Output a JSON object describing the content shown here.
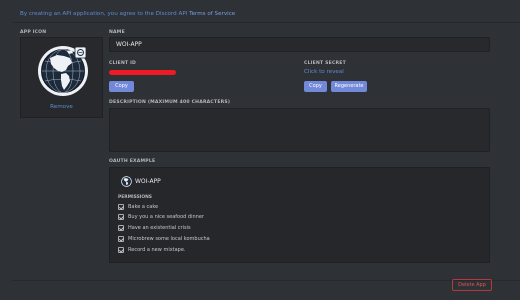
{
  "notice": {
    "text": "By creating an API application, you agree to the Discord API",
    "tos_link": "Terms of Service"
  },
  "app_icon": {
    "label": "APP ICON",
    "image": "globe-icon",
    "remove_label": "Remove"
  },
  "name": {
    "label": "NAME",
    "value": "WOI-APP"
  },
  "client_id": {
    "label": "CLIENT ID",
    "value_redacted": true,
    "redaction_color": "#ee1b24",
    "copy_label": "Copy"
  },
  "client_secret": {
    "label": "CLIENT SECRET",
    "reveal_label": "Click to reveal",
    "copy_label": "Copy",
    "regenerate_label": "Regenerate"
  },
  "description": {
    "label": "DESCRIPTION (MAXIMUM 400 CHARACTERS)",
    "value": ""
  },
  "oauth_example": {
    "label": "OAUTH EXAMPLE",
    "app_name": "WOI-APP",
    "permissions_title": "PERMISSIONS",
    "permissions": [
      "Bake a cake",
      "Buy you a nice seafood dinner",
      "Have an existential crisis",
      "Microbrew some local kombucha",
      "Record a new mixtape."
    ]
  },
  "delete_label": "Delete App",
  "colors": {
    "background": "#2e3136",
    "accent": "#7289da",
    "link": "#5e8dcf",
    "danger": "#e05555"
  }
}
